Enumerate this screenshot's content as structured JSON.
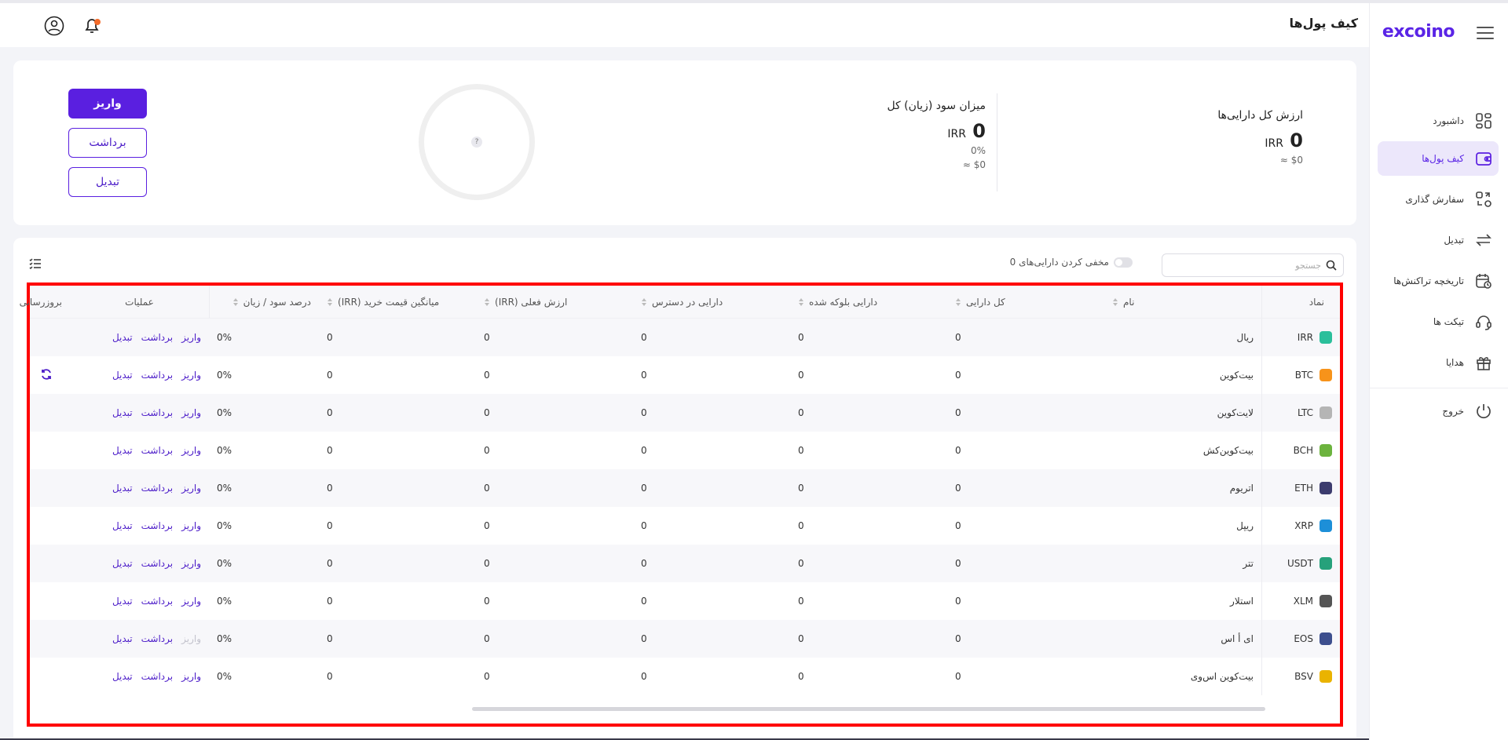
{
  "brand": "excoino",
  "header": {
    "title": "کیف پول‌ها"
  },
  "sidebar": {
    "items": [
      {
        "label": "داشبورد",
        "icon": "dashboard-icon",
        "active": false
      },
      {
        "label": "کیف پول‌ها",
        "icon": "wallet-icon",
        "active": true
      },
      {
        "label": "سفارش گذاری",
        "icon": "order-icon",
        "active": false
      },
      {
        "label": "تبدیل",
        "icon": "swap-icon",
        "active": false
      },
      {
        "label": "تاریخچه تراکنش‌ها",
        "icon": "history-icon",
        "active": false
      },
      {
        "label": "تیکت ها",
        "icon": "headset-icon",
        "active": false
      },
      {
        "label": "هدایا",
        "icon": "gift-icon",
        "active": false
      }
    ],
    "logout": {
      "label": "خروج",
      "icon": "power-icon"
    }
  },
  "summary": {
    "total_assets": {
      "title": "ارزش کل دارایی‌ها",
      "value": "0",
      "currency": "IRR",
      "usd": "≈ $0"
    },
    "profit_loss": {
      "title": "میزان سود (زیان) کل",
      "value": "0",
      "currency": "IRR",
      "percent": "0%",
      "usd": "≈ $0"
    },
    "donut_hint": "?",
    "buttons": {
      "deposit": "واریز",
      "withdraw": "برداشت",
      "convert": "تبدیل"
    }
  },
  "table": {
    "search_placeholder": "جستجو",
    "hide_label": "مخفی کردن دارایی‌های 0",
    "headers": {
      "symbol": "نماد",
      "name": "نام",
      "total": "کل دارایی",
      "blocked": "دارایی بلوکه شده",
      "available": "دارایی در دسترس",
      "current_value": "ارزش فعلی (IRR)",
      "avg_price": "میانگین قیمت خرید (IRR)",
      "pnl_pct": "درصد سود / زیان",
      "ops": "عملیات",
      "refresh": "بروزرسانی"
    },
    "ops_labels": {
      "deposit": "واریز",
      "withdraw": "برداشت",
      "convert": "تبدیل"
    },
    "rows": [
      {
        "symbol": "IRR",
        "name": "ریال",
        "total": "0",
        "blocked": "0",
        "available": "0",
        "value": "0",
        "avg": "0",
        "pct": "0%",
        "color": "#2bbf9b",
        "refresh": false,
        "deposit_disabled": false
      },
      {
        "symbol": "BTC",
        "name": "بیت‌کوین",
        "total": "0",
        "blocked": "0",
        "available": "0",
        "value": "0",
        "avg": "0",
        "pct": "0%",
        "color": "#f7931a",
        "refresh": true,
        "deposit_disabled": false
      },
      {
        "symbol": "LTC",
        "name": "لایت‌کوین",
        "total": "0",
        "blocked": "0",
        "available": "0",
        "value": "0",
        "avg": "0",
        "pct": "0%",
        "color": "#b5b5b5",
        "refresh": false,
        "deposit_disabled": false
      },
      {
        "symbol": "BCH",
        "name": "بیت‌کوین‌کش",
        "total": "0",
        "blocked": "0",
        "available": "0",
        "value": "0",
        "avg": "0",
        "pct": "0%",
        "color": "#6cb33e",
        "refresh": false,
        "deposit_disabled": false
      },
      {
        "symbol": "ETH",
        "name": "اتریوم",
        "total": "0",
        "blocked": "0",
        "available": "0",
        "value": "0",
        "avg": "0",
        "pct": "0%",
        "color": "#3c3c6e",
        "refresh": false,
        "deposit_disabled": false
      },
      {
        "symbol": "XRP",
        "name": "ریپل",
        "total": "0",
        "blocked": "0",
        "available": "0",
        "value": "0",
        "avg": "0",
        "pct": "0%",
        "color": "#1d8fd8",
        "refresh": false,
        "deposit_disabled": false
      },
      {
        "symbol": "USDT",
        "name": "تتر",
        "total": "0",
        "blocked": "0",
        "available": "0",
        "value": "0",
        "avg": "0",
        "pct": "0%",
        "color": "#26a17b",
        "refresh": false,
        "deposit_disabled": false
      },
      {
        "symbol": "XLM",
        "name": "استلار",
        "total": "0",
        "blocked": "0",
        "available": "0",
        "value": "0",
        "avg": "0",
        "pct": "0%",
        "color": "#555555",
        "refresh": false,
        "deposit_disabled": false
      },
      {
        "symbol": "EOS",
        "name": "ای أ اس",
        "total": "0",
        "blocked": "0",
        "available": "0",
        "value": "0",
        "avg": "0",
        "pct": "0%",
        "color": "#3d4f8e",
        "refresh": false,
        "deposit_disabled": true
      },
      {
        "symbol": "BSV",
        "name": "بیت‌کوین اس‌وی",
        "total": "0",
        "blocked": "0",
        "available": "0",
        "value": "0",
        "avg": "0",
        "pct": "0%",
        "color": "#eab300",
        "refresh": false,
        "deposit_disabled": false
      }
    ]
  },
  "colors": {
    "accent": "#5a1fe0",
    "highlight": "#ff0000",
    "active_bg": "#ece7fb"
  }
}
